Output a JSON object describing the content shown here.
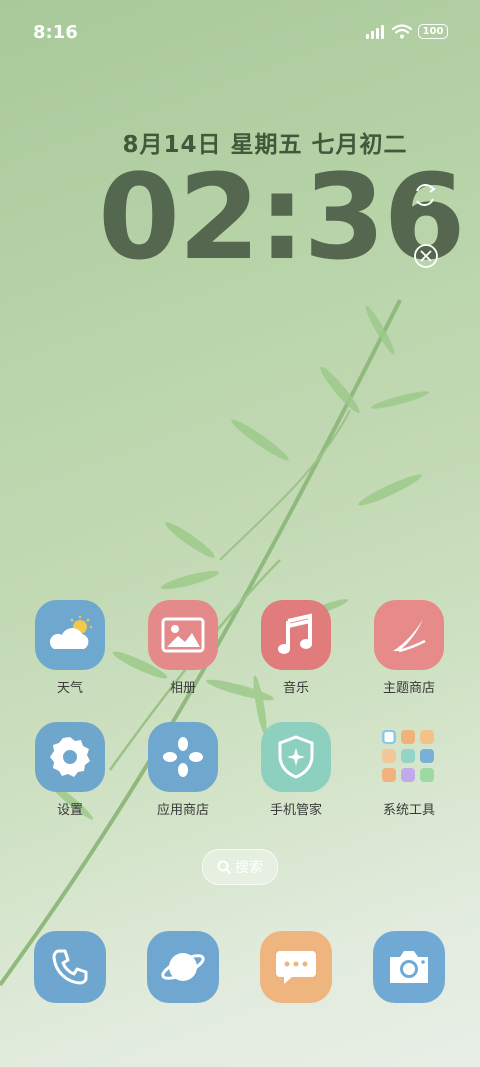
{
  "status_bar": {
    "time": "8:16",
    "battery": "100"
  },
  "lock_widget": {
    "date": "8月14日 星期五 七月初二",
    "time": "02:36"
  },
  "apps": [
    {
      "label": "天气",
      "icon": "weather-icon",
      "color": "#6fa8cf"
    },
    {
      "label": "相册",
      "icon": "gallery-icon",
      "color": "#e58a8a"
    },
    {
      "label": "音乐",
      "icon": "music-icon",
      "color": "#e07c7c"
    },
    {
      "label": "主题商店",
      "icon": "theme-store-icon",
      "color": "#e68a8a"
    },
    {
      "label": "设置",
      "icon": "settings-icon",
      "color": "#6ea6cc"
    },
    {
      "label": "应用商店",
      "icon": "app-store-icon",
      "color": "#6fa7cf"
    },
    {
      "label": "手机管家",
      "icon": "phone-manager-icon",
      "color": "#8dd0c0"
    },
    {
      "label": "系统工具",
      "icon": "system-tools-folder-icon",
      "color": "transparent"
    }
  ],
  "search": {
    "label": "搜索"
  },
  "dock": [
    {
      "name": "phone",
      "icon": "phone-icon",
      "color": "#6ea6d0"
    },
    {
      "name": "browser",
      "icon": "browser-planet-icon",
      "color": "#6fa7d0"
    },
    {
      "name": "messages",
      "icon": "messages-icon",
      "color": "#eeb57f"
    },
    {
      "name": "camera",
      "icon": "camera-icon",
      "color": "#6fa9d4"
    }
  ]
}
